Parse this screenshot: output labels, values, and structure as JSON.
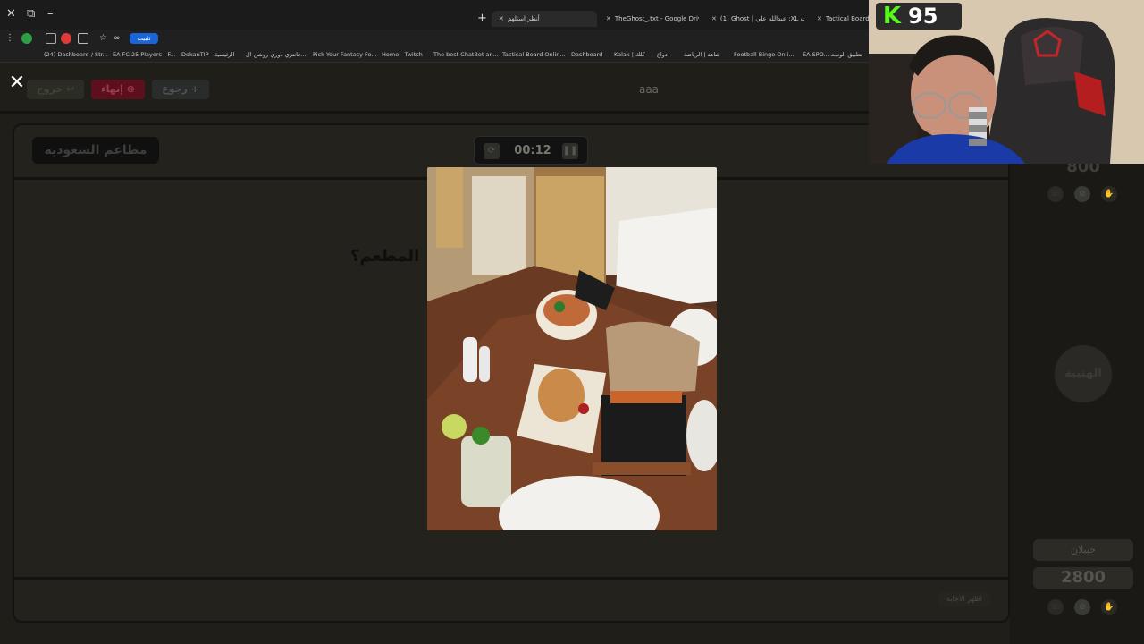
{
  "browser": {
    "tabs": [
      {
        "label": "أنظر استلهم",
        "active": true
      },
      {
        "label": "TheGhost_.txt - Google Drive",
        "active": false
      },
      {
        "label": "(1) Ghost | عبدالله علي :XL تمات",
        "active": false
      },
      {
        "label": "Tactical Board Onli",
        "active": false
      }
    ],
    "install_label": "تثبيت",
    "bookmarks": [
      "(24) Dashboard / Str...",
      "EA FC 25 Players - F...",
      "DokanTIP - الرئيسية",
      "فانتزي دوري روشن ال...",
      "Pick Your Fantasy Fo...",
      "Home - Twitch",
      "The best ChatBot an...",
      "Tactical Board Onlin...",
      "Dashboard",
      "Kalak | كلك",
      "دواع",
      "شاهد | الرياضة",
      "Football Bingo Onli...",
      "EA SPO...",
      "تطبيق الونيت"
    ]
  },
  "game": {
    "buttons": {
      "exit": "خروج ↩",
      "end": "إنهاء ⊗",
      "back": "رجوع +"
    },
    "team_name": "aaa",
    "category": "مطاعم السعودية",
    "timer": "00:12",
    "question": "المطعم؟",
    "show_answer": "اظهر الاجابة",
    "top_score": "800",
    "round_badge": "الهتيبة",
    "player": {
      "name": "خيبلان",
      "score": "2800"
    }
  },
  "stream": {
    "kick_count": "95",
    "colors": {
      "kick_green": "#53fc18"
    }
  },
  "icons": [
    "close-icon",
    "refresh-icon",
    "pause-icon",
    "star-icon",
    "kick-logo-icon"
  ]
}
